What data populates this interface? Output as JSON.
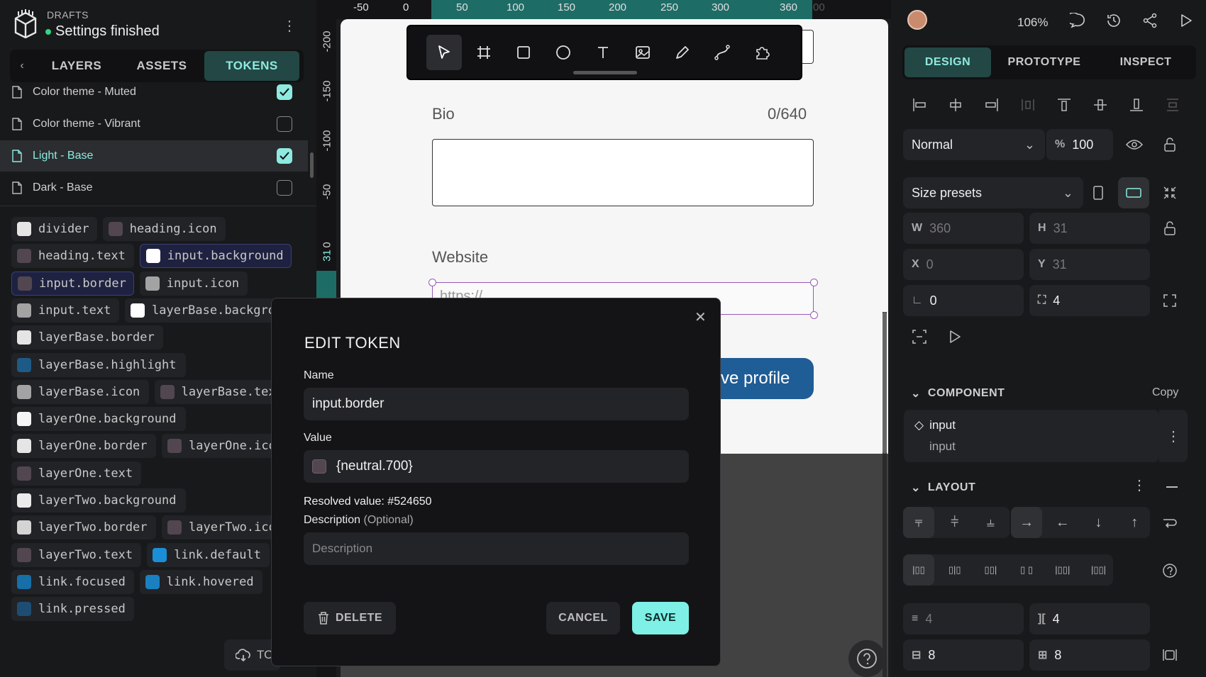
{
  "header": {
    "drafts_label": "DRAFTS",
    "file_name": "Settings finished"
  },
  "left_tabs": {
    "back_icon": "chevron-left-icon",
    "items": [
      "LAYERS",
      "ASSETS",
      "TOKENS"
    ],
    "active": "TOKENS"
  },
  "themes": [
    {
      "name": "Color theme - Muted",
      "checked": true
    },
    {
      "name": "Color theme - Vibrant",
      "checked": false
    },
    {
      "name": "Light - Base",
      "checked": true,
      "selected": true
    },
    {
      "name": "Dark - Base",
      "checked": false
    }
  ],
  "tokens": [
    {
      "name": "divider",
      "color": "#e5e5e5"
    },
    {
      "name": "heading.icon",
      "color": "#524650"
    },
    {
      "name": "heading.text",
      "color": "#524650"
    },
    {
      "name": "input.background",
      "color": "#ffffff"
    },
    {
      "name": "input.border",
      "color": "#524650"
    },
    {
      "name": "input.icon",
      "color": "#a3a3a3"
    },
    {
      "name": "input.text",
      "color": "#a3a3a3"
    },
    {
      "name": "layerBase.backgro",
      "color": "#ffffff"
    },
    {
      "name": "layerBase.border",
      "color": "#e5e5e5"
    },
    {
      "name": "layerBase.highlight",
      "color": "#1e5a86"
    },
    {
      "name": "layerBase.icon",
      "color": "#a3a3a3"
    },
    {
      "name": "layerBase.tex",
      "color": "#524650"
    },
    {
      "name": "layerOne.background",
      "color": "#f5f5f5"
    },
    {
      "name": "layerOne.border",
      "color": "#e5e5e5"
    },
    {
      "name": "layerOne.ico",
      "color": "#524650"
    },
    {
      "name": "layerOne.text",
      "color": "#524650"
    },
    {
      "name": "layerTwo.background",
      "color": "#ebebeb"
    },
    {
      "name": "layerTwo.border",
      "color": "#d4d4d4"
    },
    {
      "name": "layerTwo.ico",
      "color": "#524650"
    },
    {
      "name": "layerTwo.text",
      "color": "#524650"
    },
    {
      "name": "link.default",
      "color": "#1a8fd8"
    },
    {
      "name": "link.focused",
      "color": "#176fa8"
    },
    {
      "name": "link.hovered",
      "color": "#1a80c0"
    },
    {
      "name": "link.pressed",
      "color": "#1e4d73"
    }
  ],
  "bottom_button": {
    "label": "TO",
    "icon": "cloud-sync-icon"
  },
  "rulers": {
    "top": [
      "-50",
      "0",
      "50",
      "100",
      "150",
      "200",
      "250",
      "300",
      "360",
      "00"
    ],
    "left": [
      "-200",
      "-150",
      "-100",
      "-50",
      "0",
      "31",
      "00"
    ]
  },
  "toolbar": {
    "tools": [
      "pointer-icon",
      "board-icon",
      "rectangle-icon",
      "ellipse-icon",
      "text-icon",
      "image-icon",
      "pencil-icon",
      "path-icon",
      "plugins-icon"
    ]
  },
  "artboard": {
    "bio_label": "Bio",
    "bio_count": "0/640",
    "website_label": "Website",
    "website_placeholder": "https://",
    "save_button": "ve profile"
  },
  "modal": {
    "title": "EDIT TOKEN",
    "name_label": "Name",
    "name_value": "input.border",
    "value_label": "Value",
    "value_value": "{neutral.700}",
    "value_swatch": "#524650",
    "resolved": "Resolved value: #524650",
    "description_label": "Description",
    "description_optional": "(Optional)",
    "description_placeholder": "Description",
    "delete_label": "DELETE",
    "cancel_label": "CANCEL",
    "save_label": "SAVE"
  },
  "right": {
    "zoom": "106%",
    "tabs": [
      "DESIGN",
      "PROTOTYPE",
      "INSPECT"
    ],
    "active_tab": "DESIGN",
    "blend_mode": "Normal",
    "opacity_unit": "%",
    "opacity": "100",
    "size_presets": "Size presets",
    "w_label": "W",
    "w_value": "360",
    "h_label": "H",
    "h_value": "31",
    "x_label": "X",
    "x_value": "0",
    "y_label": "Y",
    "y_value": "31",
    "rotation": "0",
    "radius": "4",
    "component_title": "COMPONENT",
    "copy_label": "Copy",
    "component_name": "input",
    "component_sub": "input",
    "layout_title": "LAYOUT",
    "row_gap": "4",
    "col_gap": "4",
    "pad_v": "8",
    "pad_h": "8"
  }
}
